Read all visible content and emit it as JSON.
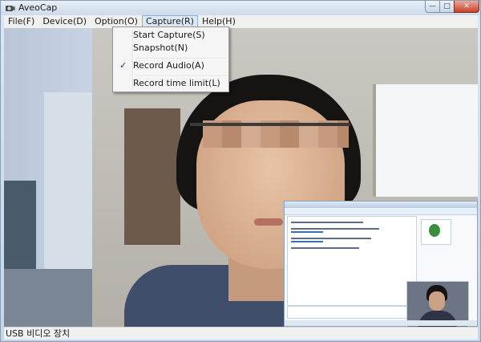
{
  "window": {
    "title": "AveoCap",
    "controls": {
      "minimize": "—",
      "maximize": "□",
      "close": "✕"
    }
  },
  "menubar": {
    "items": [
      {
        "label": "File(F)"
      },
      {
        "label": "Device(D)"
      },
      {
        "label": "Option(O)"
      },
      {
        "label": "Capture(R)",
        "open": true
      },
      {
        "label": "Help(H)"
      }
    ]
  },
  "capture_menu": {
    "items": [
      {
        "label": "Start Capture(S)",
        "checked": false
      },
      {
        "label": "Snapshot(N)",
        "checked": false
      },
      {
        "label": "Record Audio(A)",
        "checked": true,
        "check_glyph": "✓"
      },
      {
        "label": "Record time limit(L)",
        "checked": false
      }
    ]
  },
  "statusbar": {
    "text": "USB 비디오 장치"
  },
  "icons": {
    "app": "webcam-icon",
    "check": "check-icon"
  }
}
